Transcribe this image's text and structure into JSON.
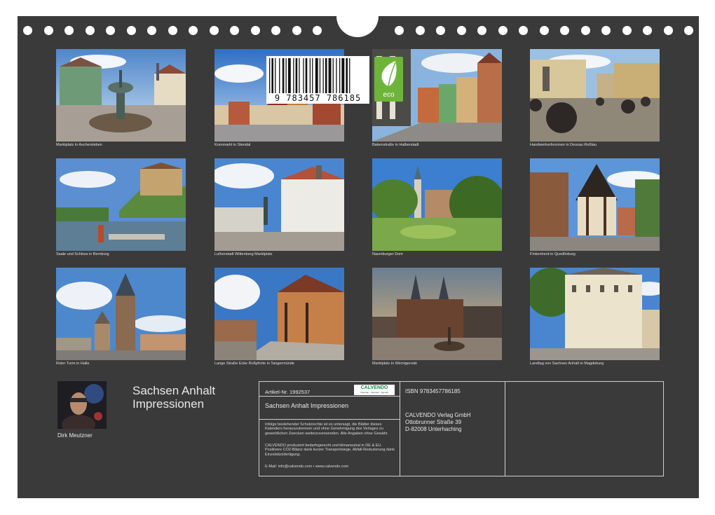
{
  "photos": [
    {
      "caption": "Marktplatz in Aschersleben"
    },
    {
      "caption": "Kornmarkt in Stendal"
    },
    {
      "caption": "Bakenstraße in Halberstadt"
    },
    {
      "caption": "Handwerkerbrunnen in Dessau Roßlau"
    },
    {
      "caption": "Saale und Schloss in Bernburg"
    },
    {
      "caption": "Lutherstadt Wittenberg Marktplatz"
    },
    {
      "caption": "Naumburger Dom"
    },
    {
      "caption": "Finkenherd in Quedlinburg"
    },
    {
      "caption": "Roter Turm in Halle"
    },
    {
      "caption": "Lange Straße Ecke Roßpforte in Tangermünde"
    },
    {
      "caption": "Marktplatz in Wernigerode"
    },
    {
      "caption": "Landtag von Sachsen Anhalt in Magdeburg"
    }
  ],
  "author": {
    "name": "Dirk Meutzner"
  },
  "title": {
    "line1": "Sachsen Anhalt",
    "line2": "Impressionen"
  },
  "info": {
    "article": "Artikel-Nr. 1992537",
    "logo": "CALVENDO",
    "logo_sub": "Calendar · Kalender · Agenda",
    "subtitle": "Sachsen Anhalt Impressionen",
    "legal1": "Infolge bestehender Schutzrechte ist es untersagt, die Blätter dieses Kalenders herauszutrennen und ohne Genehmigung des Verlages zu gewerblichen Zwecken weiterzuverwenden. Alle Angaben ohne Gewähr.",
    "legal2": "CALVENDO produziert bedarfsgerecht und klimaneutral in DE & EU. Positivere CO2-Bilanz dank kurzer Transportwege, Abfall-Reduzierung dank Einzelstückfertigung.",
    "email": "E-Mail: info@calvendo.com • www.calvendo.com",
    "isbn": "ISBN 9783457786185",
    "publisher": "CALVENDO Verlag GmbH",
    "street": "Ottobrunner Straße 39",
    "city": "D-82008 Unterhaching",
    "barcode_digits": "9 783457 786185",
    "eco": "eco"
  },
  "colors": {
    "board": "#3a3a3a",
    "eco_green": "#6fb43a",
    "calvendo_green": "#1a8f4a"
  }
}
